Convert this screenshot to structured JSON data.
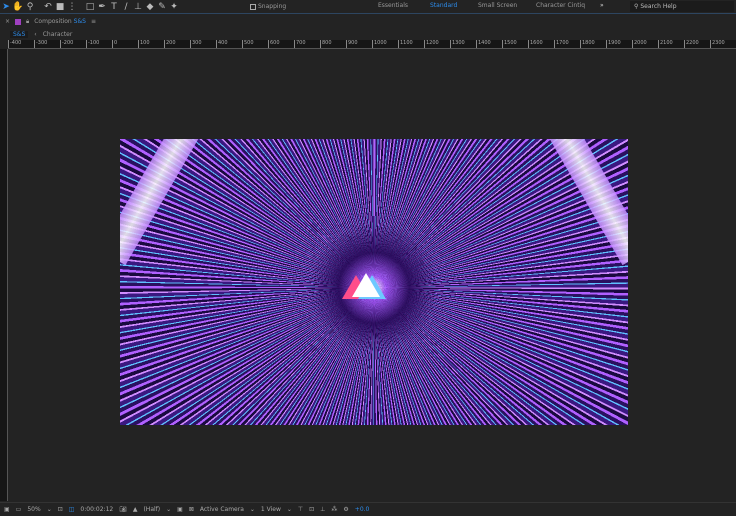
{
  "toolbar": {
    "snapping_label": "Snapping",
    "workspaces": [
      "Essentials",
      "Standard",
      "Small Screen",
      "Character Cintiq"
    ],
    "active_workspace": "Standard",
    "search_placeholder": "Search Help"
  },
  "panel": {
    "title": "Composition",
    "comp_name": "S&S"
  },
  "tabs": [
    {
      "label": "S&S"
    },
    {
      "label": "Character"
    }
  ],
  "ruler": {
    "labels": [
      "-400",
      "-300",
      "-200",
      "-100",
      "0",
      "100",
      "200",
      "300",
      "400",
      "500",
      "600",
      "700",
      "800",
      "900",
      "1000",
      "1100",
      "1200",
      "1300",
      "1400",
      "1500",
      "1600",
      "1700",
      "1800",
      "1900",
      "2000",
      "2100",
      "2200",
      "2300"
    ]
  },
  "bottom": {
    "zoom": "50%",
    "timecode": "0:00:02:12",
    "resolution": "(Half)",
    "camera": "Active Camera",
    "views": "1 View",
    "exposure": "+0.0"
  },
  "colors": {
    "accent": "#2d8ceb",
    "comp_label": "#a040c0"
  }
}
